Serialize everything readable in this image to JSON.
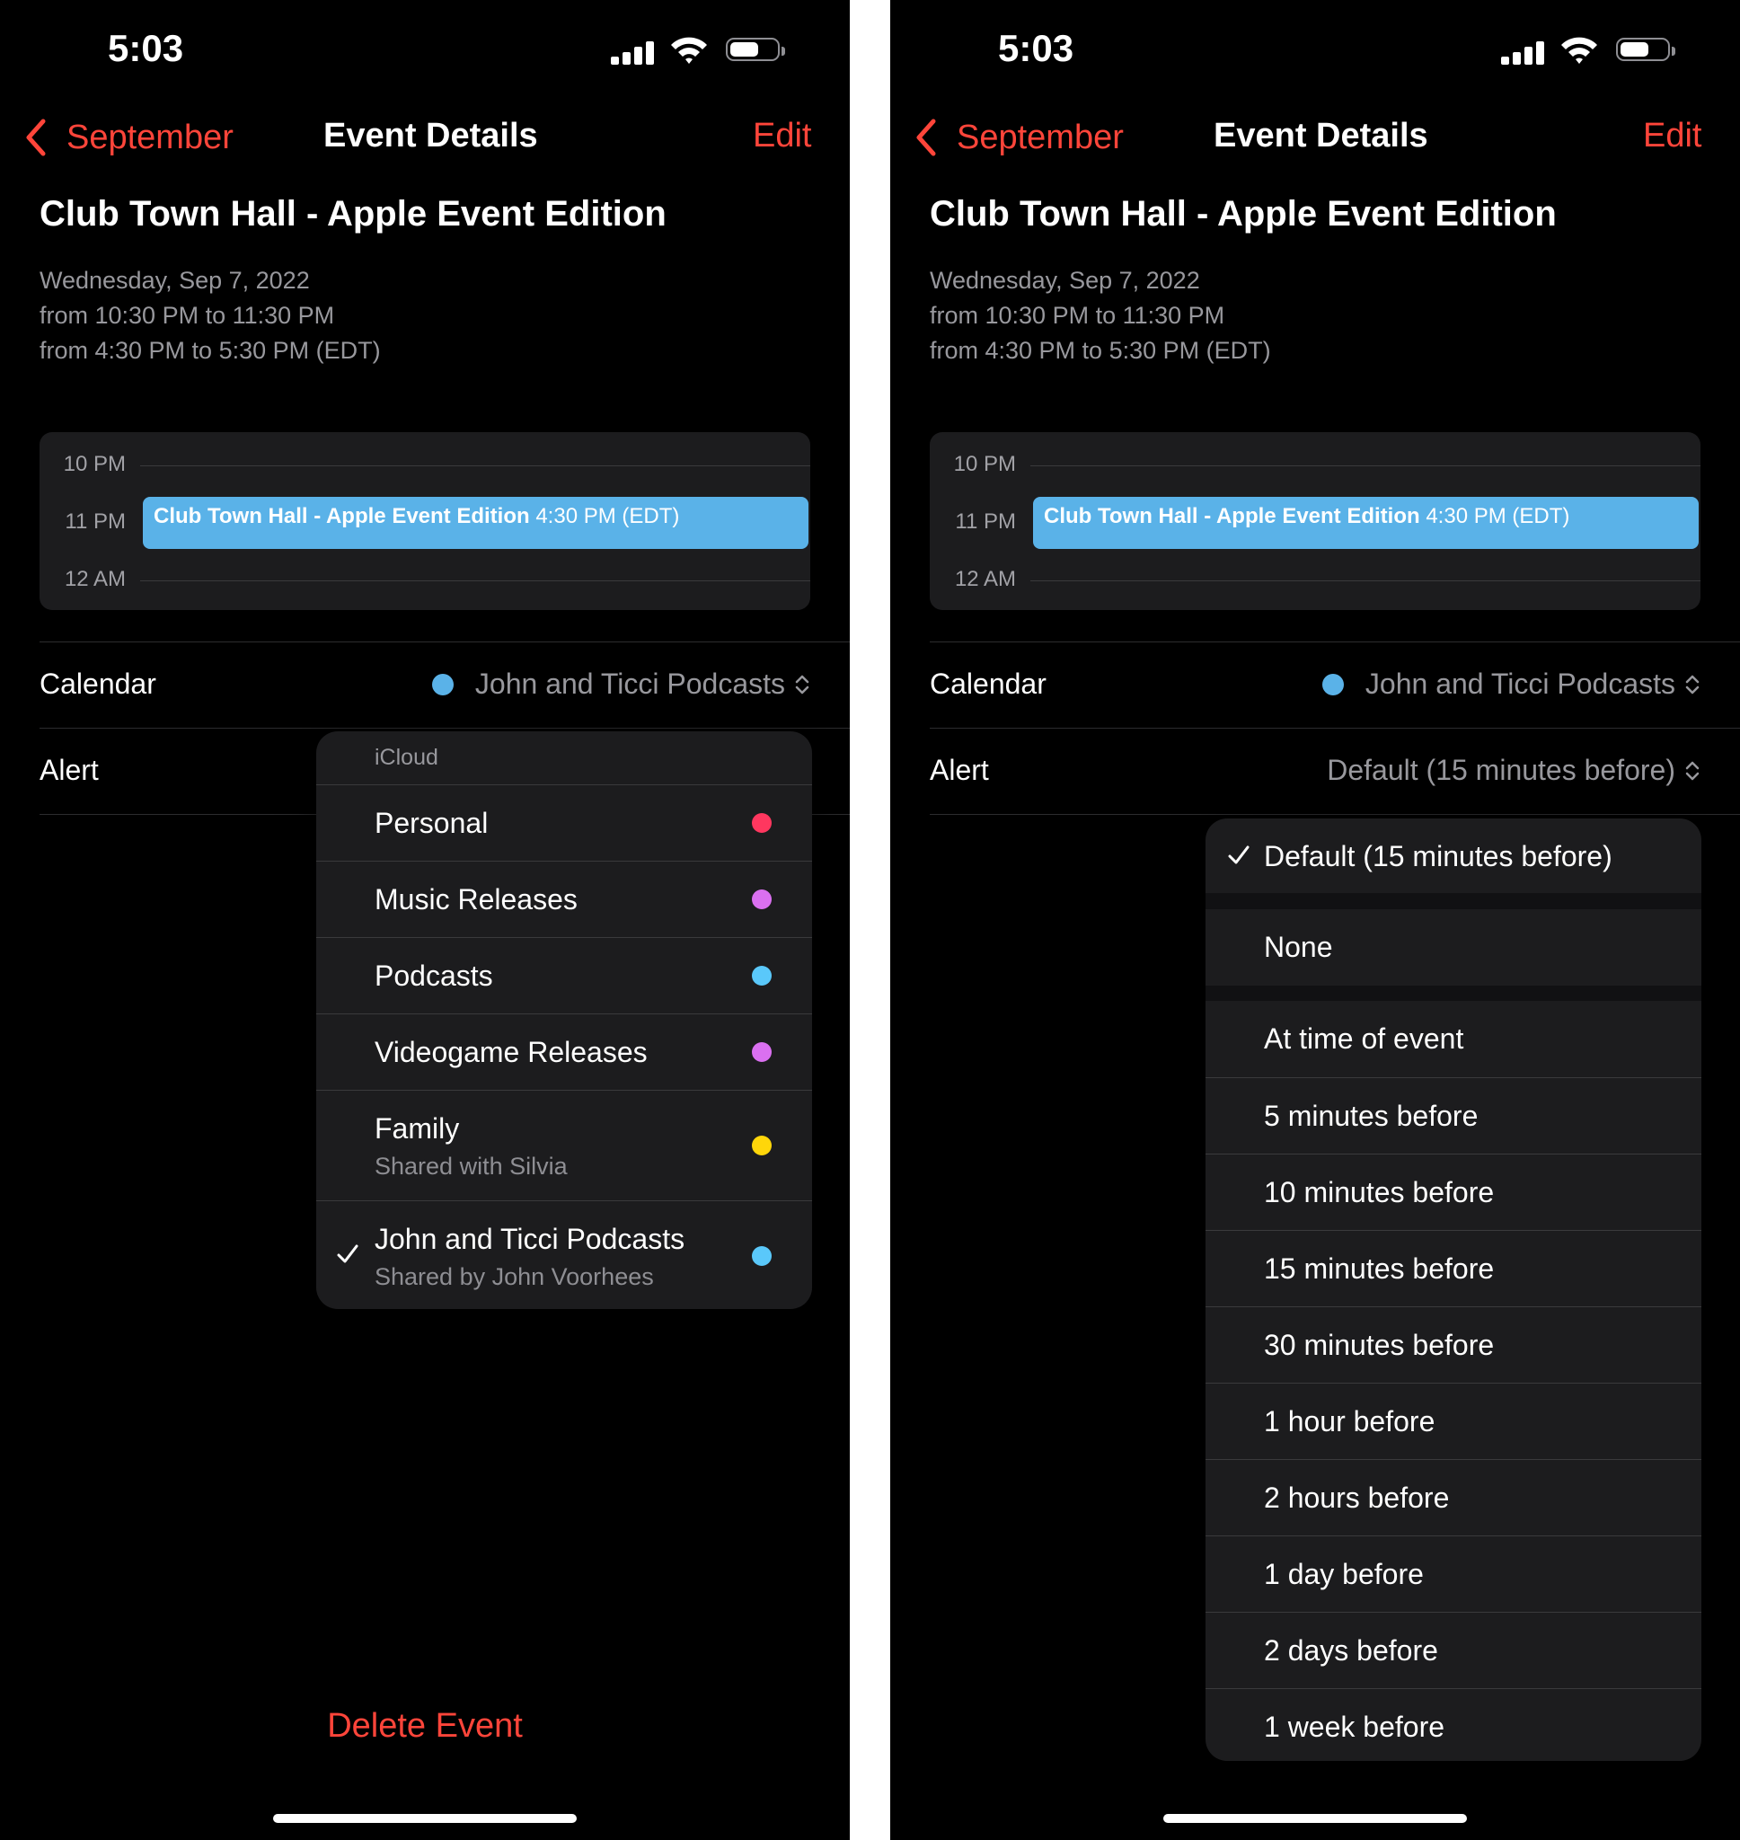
{
  "status": {
    "time": "5:03"
  },
  "nav": {
    "back_label": "September",
    "title": "Event Details",
    "edit_label": "Edit"
  },
  "event": {
    "title": "Club Town Hall - Apple Event Edition",
    "date": "Wednesday, Sep 7, 2022",
    "time_local": "from 10:30 PM to 11:30 PM",
    "time_edt": "from 4:30 PM to 5:30 PM (EDT)"
  },
  "timeline": {
    "labels": [
      "10 PM",
      "11 PM",
      "12 AM"
    ],
    "event_name": "Club Town Hall - Apple Event Edition",
    "event_time": "4:30 PM (EDT)"
  },
  "calendar_row": {
    "label": "Calendar",
    "value": "John and Ticci Podcasts",
    "dot_color": "#5ab2e8"
  },
  "alert_row": {
    "label": "Alert",
    "value": "Default (15 minutes before)"
  },
  "calendar_menu": {
    "header": "iCloud",
    "items": [
      {
        "name": "Personal",
        "sub": "",
        "color": "#ff375f",
        "checked": false
      },
      {
        "name": "Music Releases",
        "sub": "",
        "color": "#da70f0",
        "checked": false
      },
      {
        "name": "Podcasts",
        "sub": "",
        "color": "#5ac8fa",
        "checked": false
      },
      {
        "name": "Videogame Releases",
        "sub": "",
        "color": "#da70f0",
        "checked": false
      },
      {
        "name": "Family",
        "sub": "Shared with Silvia",
        "color": "#ffd60a",
        "checked": false
      },
      {
        "name": "John and Ticci Podcasts",
        "sub": "Shared by John Voorhees",
        "color": "#5ac8fa",
        "checked": true
      }
    ]
  },
  "alert_menu": {
    "selected": "Default (15 minutes before)",
    "none": "None",
    "options": [
      "At time of event",
      "5 minutes before",
      "10 minutes before",
      "15 minutes before",
      "30 minutes before",
      "1 hour before",
      "2 hours before",
      "1 day before",
      "2 days before",
      "1 week before"
    ]
  },
  "delete_label": "Delete Event",
  "accent_color": "#ff453a"
}
